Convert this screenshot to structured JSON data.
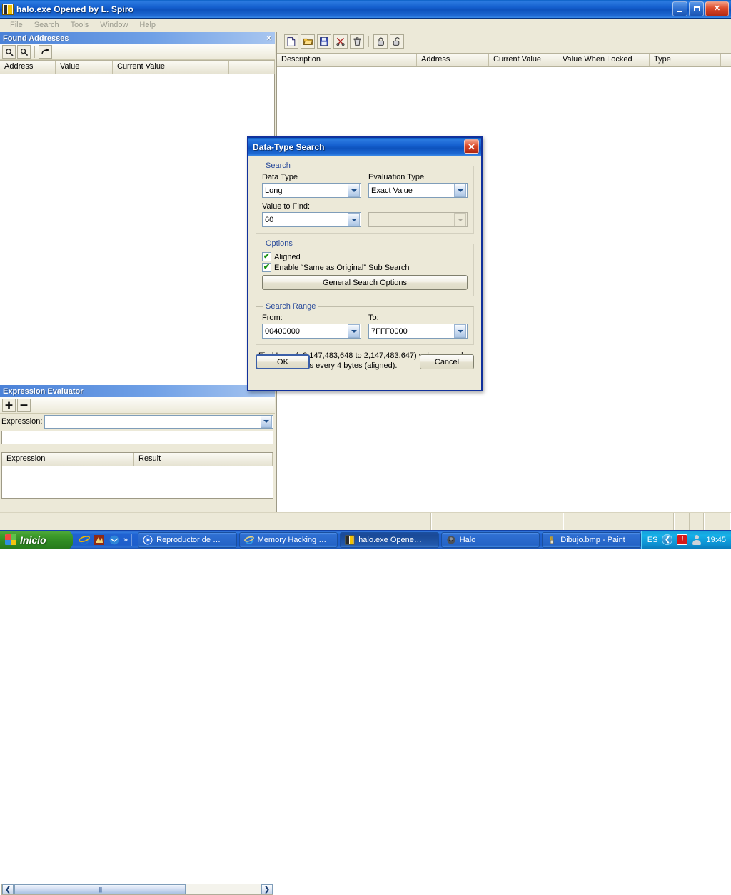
{
  "window": {
    "title": "halo.exe Opened by L. Spiro",
    "icon": "app-icon",
    "buttons": {
      "minimize": "_",
      "maximize": "□",
      "close": "×"
    }
  },
  "menubar": {
    "items": [
      {
        "label": "File"
      },
      {
        "label": "Search"
      },
      {
        "label": "Tools"
      },
      {
        "label": "Window"
      },
      {
        "label": "Help"
      }
    ]
  },
  "found_addresses": {
    "caption": "Found Addresses",
    "close_glyph": "×",
    "toolbar": [
      {
        "name": "search-icon",
        "glyph": "🔍"
      },
      {
        "name": "search-next-icon",
        "glyph": "🔎"
      },
      {
        "name": "move-to-table-icon",
        "glyph": "↪"
      }
    ],
    "columns": [
      "Address",
      "Value",
      "Current Value"
    ],
    "rows": []
  },
  "expression_evaluator": {
    "caption": "Expression Evaluator",
    "toolbar": [
      {
        "name": "add-icon",
        "glyph": "➕"
      },
      {
        "name": "remove-icon",
        "glyph": "➖"
      }
    ],
    "expression_label": "Expression:",
    "expression_value": "",
    "expression_placeholder": "",
    "result_value": "",
    "columns": [
      "Expression",
      "Result"
    ],
    "rows": [],
    "scroll_left_glyph": "❮",
    "scroll_right_glyph": "❯",
    "thumb_grip": "||||"
  },
  "cheat_table": {
    "toolbar": [
      {
        "name": "new-file-icon",
        "glyph": "🗋"
      },
      {
        "name": "open-folder-icon",
        "glyph": "📂"
      },
      {
        "name": "save-disk-icon",
        "glyph": "💾"
      },
      {
        "name": "cut-scissors-icon",
        "glyph": "✂"
      },
      {
        "name": "delete-trash-icon",
        "glyph": "🗑"
      },
      {
        "name": "lock-closed-icon",
        "glyph": "🔒"
      },
      {
        "name": "lock-open-icon",
        "glyph": "🔓"
      }
    ],
    "columns": [
      "Description",
      "Address",
      "Current Value",
      "Value When Locked",
      "Type"
    ],
    "rows": []
  },
  "statusbar": {
    "panes": [
      "",
      "",
      "",
      "",
      "",
      ""
    ]
  },
  "dialog": {
    "title": "Data-Type Search",
    "close_glyph": "×",
    "search_group": {
      "legend": "Search",
      "data_type_label": "Data Type",
      "data_type_value": "Long",
      "evaluation_type_label": "Evaluation Type",
      "evaluation_type_value": "Exact Value",
      "value_to_find_label": "Value to Find:",
      "value_to_find_value": "60",
      "second_value_value": "",
      "second_value_disabled": true
    },
    "options_group": {
      "legend": "Options",
      "aligned_label": "Aligned",
      "aligned_checked": true,
      "sub_search_label": "Enable “Same as Original” Sub Search",
      "sub_search_checked": true,
      "general_options_button": "General Search Options",
      "check_glyph": "✔"
    },
    "range_group": {
      "legend": "Search Range",
      "from_label": "From:",
      "from_value": "00400000",
      "to_label": "To:",
      "to_value": "7FFF0000"
    },
    "description": "Find Long (−2,147,483,648 to 2,147,483,647) values equal to 60. Searches every 4 bytes (aligned).",
    "ok_button": "OK",
    "cancel_button": "Cancel"
  },
  "taskbar": {
    "start_label": "Inicio",
    "quicklaunch": [
      {
        "name": "internet-explorer-icon",
        "color": "#1d6fd0"
      },
      {
        "name": "winamp-icon",
        "color": "#8a2a18"
      },
      {
        "name": "outlook-express-icon",
        "color": "#2f86d8"
      }
    ],
    "quicklaunch_chevron": "»",
    "tasks": [
      {
        "label": "Reproductor de …",
        "icon": "media-player-icon",
        "icon_color": "#2f6fd8",
        "active": false
      },
      {
        "label": "Memory Hacking …",
        "icon": "internet-explorer-icon",
        "icon_color": "#2f86d8",
        "active": false
      },
      {
        "label": "halo.exe Opene…",
        "icon": "app-icon",
        "icon_color": "#f2c200",
        "active": true
      },
      {
        "label": "Halo",
        "icon": "halo-icon",
        "icon_color": "#5a5f66",
        "active": false
      },
      {
        "label": "Dibujo.bmp - Paint",
        "icon": "paint-icon",
        "icon_color": "#c9a227",
        "active": false
      }
    ],
    "tray": {
      "language": "ES",
      "chevron_glyph": "❮",
      "shield_glyph": "!",
      "user_icon": "user-account-icon",
      "clock": "19:45"
    }
  },
  "colors": {
    "titlebar_blue": "#1560cf",
    "dialog_border": "#11319c",
    "face": "#ece9d8",
    "group_legend": "#2a4b9b",
    "check_green": "#18920e",
    "start_green": "#3e9c2c"
  }
}
